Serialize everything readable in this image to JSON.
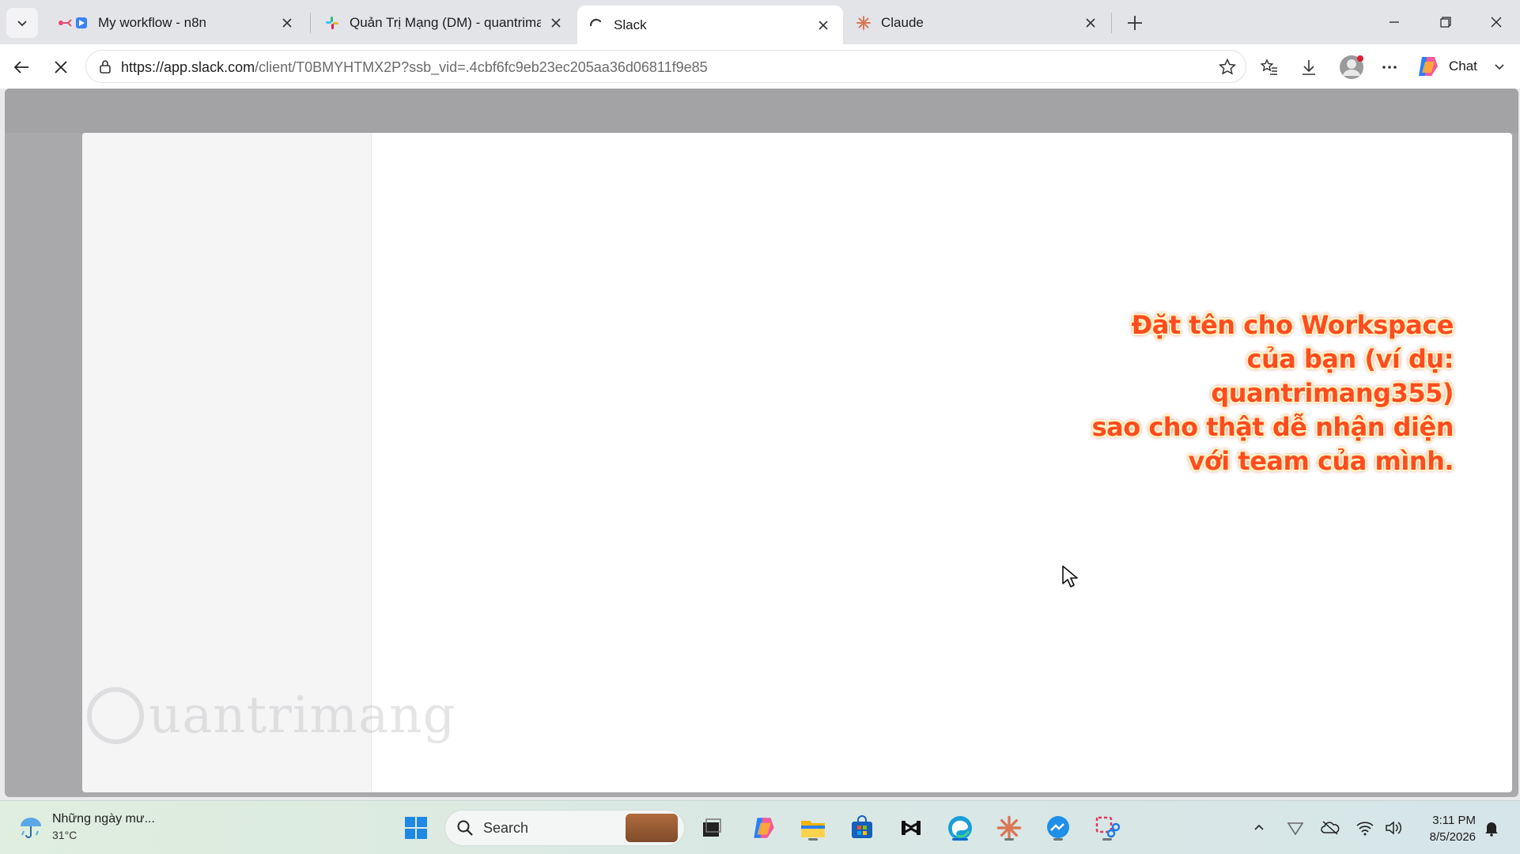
{
  "browser": {
    "tabs": [
      {
        "title": "My workflow - n8n",
        "favicon": "n8n-icon",
        "active": false
      },
      {
        "title": "Quản Trị Mạng (DM) - quantrimang",
        "favicon": "slack-icon",
        "active": false
      },
      {
        "title": "Slack",
        "favicon": "loading-spinner-icon",
        "active": true
      },
      {
        "title": "Claude",
        "favicon": "claude-icon",
        "active": false
      }
    ],
    "url_host": "https://app.slack.com",
    "url_path": "/client/T0BMYHTMX2P?ssb_vid=.4cbf6fc9eb23ec205aa36d06811f9e85",
    "chat_label": "Chat"
  },
  "page": {
    "annotation_lines": [
      "Đặt tên cho Workspace",
      "của bạn (ví dụ: quantrimang355)",
      "sao cho thật dễ nhận diện",
      "với team của mình."
    ],
    "watermark": "uantrimang"
  },
  "taskbar": {
    "weather_text": "Những ngày mư...",
    "weather_temp": "31°C",
    "search_label": "Search",
    "time": "3:11 PM",
    "date": "8/5/2026"
  },
  "colors": {
    "annotation_text": "#ff4b1f",
    "annotation_outline": "#fff3c4",
    "active_indicator": "#0a68c7"
  }
}
